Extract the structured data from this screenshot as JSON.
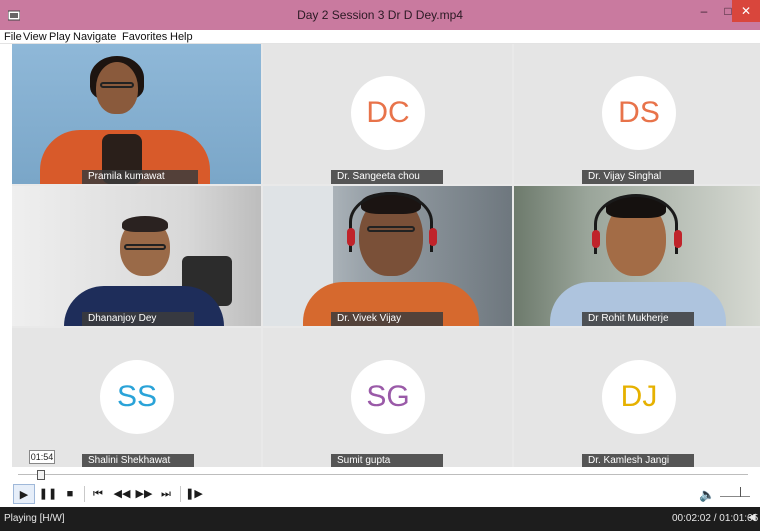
{
  "window": {
    "title": "Day 2 Session 3 Dr D Dey.mp4",
    "minimize": "–",
    "maximize": "□",
    "close": "✕"
  },
  "menu": [
    "File",
    "View",
    "Play",
    "Navigate",
    "Favorites",
    "Help"
  ],
  "participants": [
    {
      "name": "Pramila kumawat",
      "video": true
    },
    {
      "name": "Dr. Sangeeta chou",
      "initials": "DC",
      "color": "#e8734a"
    },
    {
      "name": "Dr. Vijay Singhal",
      "initials": "DS",
      "color": "#e8734a"
    },
    {
      "name": "Dhananjoy Dey",
      "video": true
    },
    {
      "name": "Dr. Vivek Vijay",
      "video": true
    },
    {
      "name": "Dr Rohit Mukherje",
      "video": true
    },
    {
      "name": "Shalini Shekhawat",
      "initials": "SS",
      "color": "#2aa3d8"
    },
    {
      "name": "Sumit gupta",
      "initials": "SG",
      "color": "#9a5aa8"
    },
    {
      "name": "Dr. Kamlesh Jangi",
      "initials": "DJ",
      "color": "#e6b100"
    }
  ],
  "seek": {
    "tooltip": "01:54",
    "position_fraction": 0.028
  },
  "controls": {
    "play": "▶",
    "pause": "❚❚",
    "stop": "■",
    "prev": "⏮",
    "rewind": "◀◀",
    "forward": "▶▶",
    "next": "⏭",
    "frame_step": "❚▶",
    "volume_icon": "🔈"
  },
  "status": {
    "state": "Playing [H/W]",
    "time": "00:02:02 / 01:01:05",
    "speaker": "◀"
  }
}
